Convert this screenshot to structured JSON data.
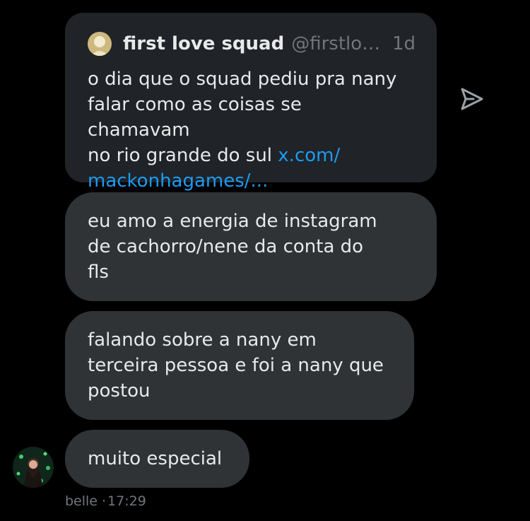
{
  "quote": {
    "name": "first love squad",
    "handle": "@firstlove...",
    "time": "1d",
    "text_lines": [
      "o dia que o squad pediu pra nany",
      "falar como as coisas se chamavam",
      "no rio grande do sul "
    ],
    "link_line1": "x.com/",
    "link_line2": "mackonhagames/..."
  },
  "messages": [
    {
      "lines": [
        "eu amo a energia de instagram",
        "de cachorro/nene da conta do",
        "fls"
      ]
    },
    {
      "lines": [
        "falando sobre a nany em",
        "terceira pessoa e foi a nany que",
        "postou"
      ]
    },
    {
      "lines": [
        "muito especial"
      ]
    }
  ],
  "meta": {
    "sender": "belle",
    "separator": "·",
    "time": "17:29"
  },
  "icons": {
    "share": "share-arrow-icon",
    "quote_avatar": "quote-avatar",
    "sender_avatar": "sender-avatar"
  },
  "colors": {
    "background": "#000000",
    "bubble": "#2f3336",
    "quote_card": "#202327",
    "text": "#e7e9ea",
    "muted": "#71767b",
    "link": "#1d9bf0"
  }
}
